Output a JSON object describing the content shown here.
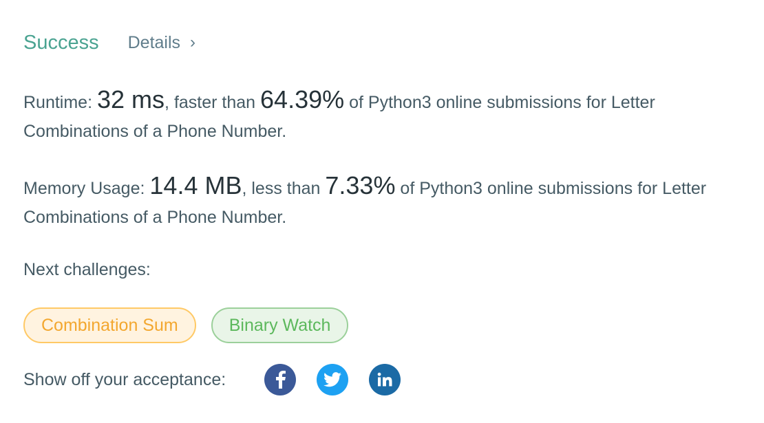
{
  "header": {
    "status": "Success",
    "details_label": "Details",
    "chevron_icon": "chevron-right"
  },
  "runtime": {
    "label": "Runtime:",
    "value": "32 ms",
    "comparator": ", faster than",
    "percentile": "64.39%",
    "suffix": "of Python3 online submissions for Letter Combinations of a Phone Number."
  },
  "memory": {
    "label": "Memory Usage:",
    "value": "14.4 MB",
    "comparator": ", less than",
    "percentile": "7.33%",
    "suffix": "of Python3 online submissions for Letter Combinations of a Phone Number."
  },
  "next": {
    "label": "Next challenges:",
    "challenges": [
      {
        "title": "Combination Sum",
        "difficulty_color": "#f3a72f"
      },
      {
        "title": "Binary Watch",
        "difficulty_color": "#5cb85c"
      }
    ]
  },
  "share": {
    "label": "Show off your acceptance:",
    "icons": [
      {
        "name": "facebook-icon",
        "color": "#3b5998"
      },
      {
        "name": "twitter-icon",
        "color": "#1da1f2"
      },
      {
        "name": "linkedin-icon",
        "color": "#1b6aa5"
      }
    ]
  }
}
